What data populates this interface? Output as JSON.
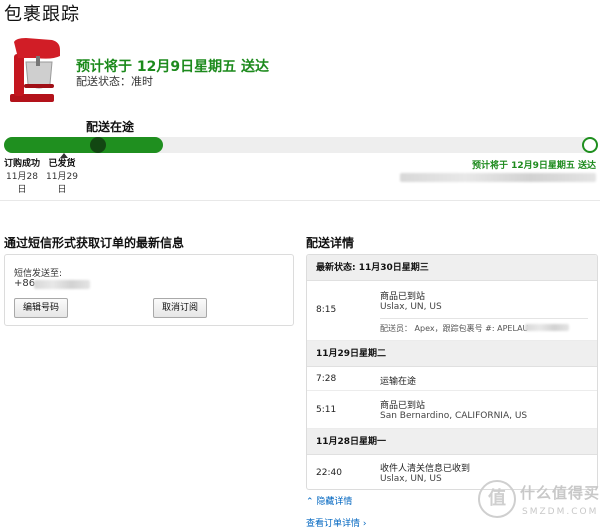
{
  "page": {
    "title": "包裹跟踪"
  },
  "shipment": {
    "eta_headline": "预计将于 12月9日星期五 送达",
    "delivery_status": "配送状态：准时",
    "current_stage": "配送在途",
    "progress": {
      "fraction": 0.27,
      "marker_fraction": 0.16
    },
    "steps": [
      {
        "title": "订购成功",
        "date": "11月28日"
      },
      {
        "title": "已发货",
        "date": "11月29日"
      }
    ],
    "eta_right": "预计将于 12月9日星期五 送达"
  },
  "sms": {
    "title": "通过短信形式获取订单的最新信息",
    "sent_to_label": "短信发送至:",
    "phone_prefix": "+86",
    "edit_button": "编辑号码",
    "cancel_button": "取消订阅"
  },
  "details": {
    "title": "配送详情",
    "latest_status": "最新状态: 11月30日星期三",
    "groups": [
      {
        "events": [
          {
            "time": "8:15",
            "desc": "商品已到站",
            "location": "Uslax, UN, US",
            "courier": "配送员： Apex，跟踪包裹号 #: APELAU"
          }
        ]
      },
      {
        "header": "11月29日星期二",
        "events": [
          {
            "time": "7:28",
            "desc": "运输在途"
          },
          {
            "time": "5:11",
            "desc": "商品已到站",
            "location": "San Bernardino, CALIFORNIA, US"
          }
        ]
      },
      {
        "header": "11月28日星期一",
        "events": [
          {
            "time": "22:40",
            "desc": "收件人清关信息已收到",
            "location": "Uslax, UN, US"
          }
        ]
      }
    ],
    "hide_link": "隐藏详情",
    "order_link": "查看订单详情 ›"
  },
  "watermark": {
    "glyph": "值",
    "text": "什么值得买",
    "sub": "SMZDM.COM"
  },
  "colors": {
    "accent_green": "#1f8f1f",
    "link_blue": "#0066c0"
  }
}
